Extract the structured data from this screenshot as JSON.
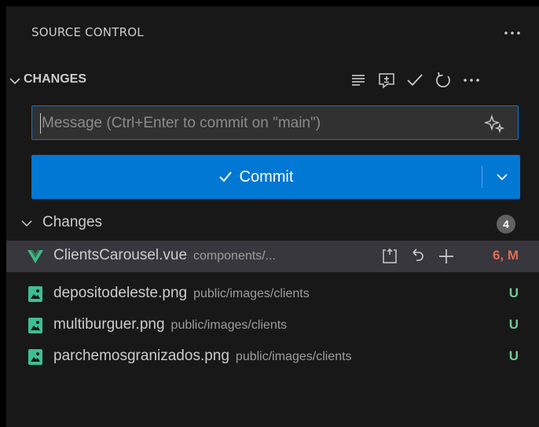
{
  "header": {
    "title": "SOURCE CONTROL",
    "more_icon": "ellipsis-icon"
  },
  "section": {
    "title": "CHANGES",
    "actions": [
      "view-as-tree-icon",
      "open-changes-icon",
      "commit-check-icon",
      "refresh-icon",
      "ellipsis-icon"
    ]
  },
  "message": {
    "value": "",
    "placeholder": "Message (Ctrl+Enter to commit on \"main\")",
    "sparkle_icon": "sparkle-icon"
  },
  "commit": {
    "label": "Commit",
    "check_icon": "check-icon",
    "dropdown_icon": "chevron-down-icon"
  },
  "changes_group": {
    "label": "Changes",
    "count": "4"
  },
  "files": [
    {
      "name": "ClientsCarousel.vue",
      "dir": "components/...",
      "status": "6, M",
      "status_color": "#e06c55",
      "icon": "vue-file-icon",
      "selected": true
    },
    {
      "name": "depositodeleste.png",
      "dir": "public/images/clients",
      "status": "U",
      "status_color": "#73c991",
      "icon": "image-file-icon",
      "selected": false
    },
    {
      "name": "multiburguer.png",
      "dir": "public/images/clients",
      "status": "U",
      "status_color": "#73c991",
      "icon": "image-file-icon",
      "selected": false
    },
    {
      "name": "parchemosgranizados.png",
      "dir": "public/images/clients",
      "status": "U",
      "status_color": "#73c991",
      "icon": "image-file-icon",
      "selected": false
    }
  ],
  "row_actions": [
    "open-file-icon",
    "discard-changes-icon",
    "stage-changes-icon"
  ],
  "colors": {
    "background": "#181818",
    "accent": "#0078d4",
    "modified": "#e06c55",
    "untracked": "#73c991",
    "vue": "#41b883",
    "image": "#3dbf93"
  }
}
